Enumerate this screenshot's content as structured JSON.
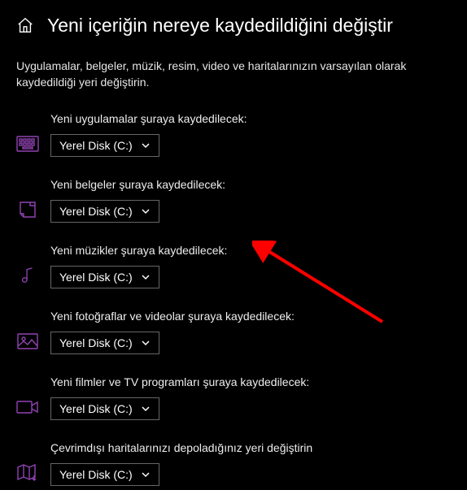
{
  "title": "Yeni içeriğin nereye kaydedildiğini değiştir",
  "description": "Uygulamalar, belgeler, müzik, resim, video ve haritalarınızın varsayılan olarak kaydedildiği yeri değiştirin.",
  "default_value": "Yerel Disk (C:)",
  "accent": "#9143b3",
  "groups": [
    {
      "icon": "apps",
      "label": "Yeni uygulamalar şuraya kaydedilecek:",
      "value": "Yerel Disk (C:)"
    },
    {
      "icon": "docs",
      "label": "Yeni belgeler şuraya kaydedilecek:",
      "value": "Yerel Disk (C:)"
    },
    {
      "icon": "music",
      "label": "Yeni müzikler şuraya kaydedilecek:",
      "value": "Yerel Disk (C:)"
    },
    {
      "icon": "photos",
      "label": "Yeni fotoğraflar ve videolar şuraya kaydedilecek:",
      "value": "Yerel Disk (C:)"
    },
    {
      "icon": "movies",
      "label": "Yeni filmler ve TV programları şuraya kaydedilecek:",
      "value": "Yerel Disk (C:)"
    },
    {
      "icon": "maps",
      "label": "Çevrimdışı haritalarınızı depoladığınız yeri değiştirin",
      "value": "Yerel Disk (C:)"
    }
  ]
}
